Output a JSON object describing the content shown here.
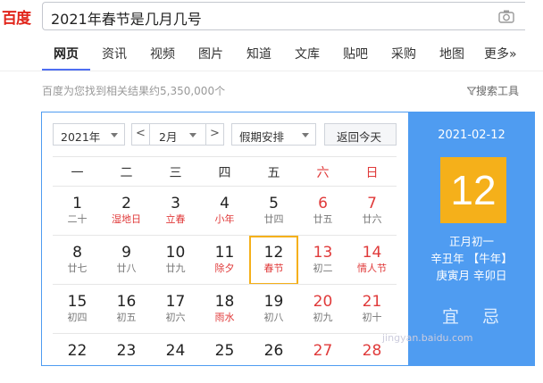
{
  "logo": "百度",
  "search": {
    "query": "2021年春节是几月几号"
  },
  "tabs": [
    "网页",
    "资讯",
    "视频",
    "图片",
    "知道",
    "文库",
    "贴吧",
    "采购",
    "地图",
    "更多»"
  ],
  "result_count": "百度为您找到相关结果约5,350,000个",
  "search_tools": "搜索工具",
  "calendar": {
    "year_select": "2021年",
    "month_select": "2月",
    "holiday_select": "假期安排",
    "today_button": "返回今天",
    "prev_arrow": "<",
    "next_arrow": ">",
    "weekdays": [
      "一",
      "二",
      "三",
      "四",
      "五",
      "六",
      "日"
    ],
    "rows": [
      [
        {
          "d": "1",
          "l": "二十"
        },
        {
          "d": "2",
          "l": "湿地日"
        },
        {
          "d": "3",
          "l": "立春"
        },
        {
          "d": "4",
          "l": "小年"
        },
        {
          "d": "5",
          "l": "廿四"
        },
        {
          "d": "6",
          "l": "廿五"
        },
        {
          "d": "7",
          "l": "廿六"
        }
      ],
      [
        {
          "d": "8",
          "l": "廿七"
        },
        {
          "d": "9",
          "l": "廿八"
        },
        {
          "d": "10",
          "l": "廿九"
        },
        {
          "d": "11",
          "l": "除夕"
        },
        {
          "d": "12",
          "l": "春节"
        },
        {
          "d": "13",
          "l": "初二"
        },
        {
          "d": "14",
          "l": "情人节"
        }
      ],
      [
        {
          "d": "15",
          "l": "初四"
        },
        {
          "d": "16",
          "l": "初五"
        },
        {
          "d": "17",
          "l": "初六"
        },
        {
          "d": "18",
          "l": "雨水"
        },
        {
          "d": "19",
          "l": "初八"
        },
        {
          "d": "20",
          "l": "初九"
        },
        {
          "d": "21",
          "l": "初十"
        }
      ],
      [
        {
          "d": "22",
          "l": ""
        },
        {
          "d": "23",
          "l": ""
        },
        {
          "d": "24",
          "l": ""
        },
        {
          "d": "25",
          "l": ""
        },
        {
          "d": "26",
          "l": ""
        },
        {
          "d": "27",
          "l": ""
        },
        {
          "d": "28",
          "l": ""
        }
      ]
    ],
    "red_lunar": [
      "湿地日",
      "立春",
      "小年",
      "除夕",
      "春节",
      "情人节",
      "雨水"
    ],
    "selected_day": "12",
    "side": {
      "date": "2021-02-12",
      "day": "12",
      "lunar": "正月初一",
      "ganzhi_year": "辛丑年 【牛年】",
      "ganzhi_month_day": "庚寅月 辛卯日",
      "yi": "宜 忌"
    }
  },
  "watermark": "jingyan.baidu.com",
  "colors": {
    "accent": "#4f9cf1",
    "highlight": "#f5b01a",
    "red": "#e03a3a",
    "tab_underline": "#4e6ef2"
  },
  "icons": [
    "camera-icon",
    "funnel-icon",
    "chevron-left-icon",
    "chevron-right-icon",
    "caret-down-icon"
  ]
}
